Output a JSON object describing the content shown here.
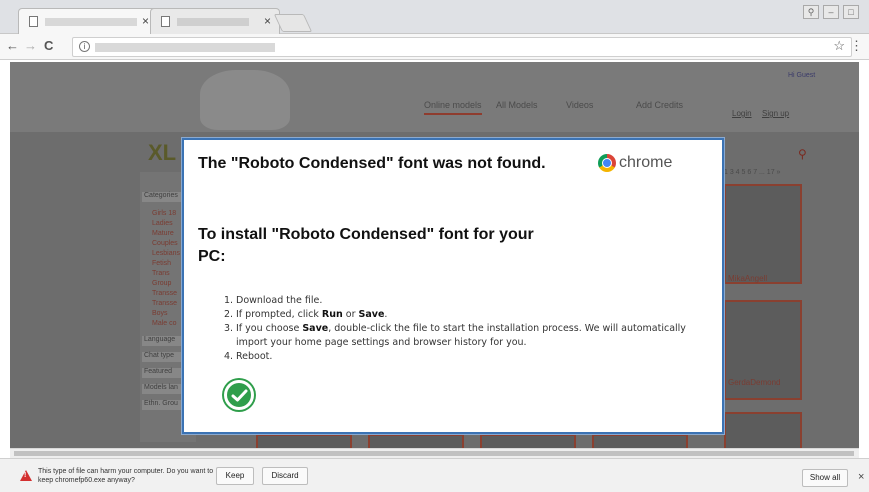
{
  "browser": {
    "tabs": [
      {
        "title": "",
        "close": "×"
      },
      {
        "title": "",
        "close": "×"
      }
    ],
    "nav": {
      "back": "←",
      "forward": "→",
      "reload": "C"
    },
    "omnibox": {
      "url": ""
    }
  },
  "site": {
    "nav_items": [
      "Online models",
      "All Models",
      "Videos",
      "Add Credits"
    ],
    "login": "Login",
    "signup": "Sign up",
    "hi": "Hi Guest",
    "brand": "XL",
    "pager": "1 3 4 5 6 7 ... 17 »",
    "side_headings": [
      "Categories",
      "Language",
      "Chat type",
      "Featured",
      "Models lan",
      "Ethn. Grou"
    ],
    "side_items": [
      "Girls 18",
      "Ladies",
      "Mature",
      "Couples",
      "Lesbians",
      "Fetish",
      "Trans",
      "Group",
      "Transse",
      "Transse",
      "Boys",
      "Male co"
    ],
    "thumb_labels": [
      "MikaAngell",
      "GerdaDemond"
    ]
  },
  "dialog": {
    "title": "The \"Roboto Condensed\" font was not found.",
    "brand": "chrome",
    "subtitle": "To install \"Roboto Condensed\" font for your PC:",
    "steps": [
      {
        "num": "1.",
        "parts": [
          "Download the file."
        ]
      },
      {
        "num": "2.",
        "parts": [
          "If prompted, click ",
          "Run",
          " or ",
          "Save",
          "."
        ]
      },
      {
        "num": "3.",
        "parts": [
          "If you choose ",
          "Save",
          ", double-click the file to start the installation process. We will automatically import your home page settings and browser history for you."
        ]
      },
      {
        "num": "4.",
        "parts": [
          "Reboot."
        ]
      }
    ]
  },
  "download_bar": {
    "message": "This type of file can harm your computer. Do you want to keep chromefp60.exe anyway?",
    "keep": "Keep",
    "discard": "Discard",
    "show_all": "Show all",
    "close": "×"
  },
  "colors": {
    "dialog_border": "#3b73b4",
    "check_green": "#2f9e4b",
    "warning_red": "#d32f2f"
  }
}
